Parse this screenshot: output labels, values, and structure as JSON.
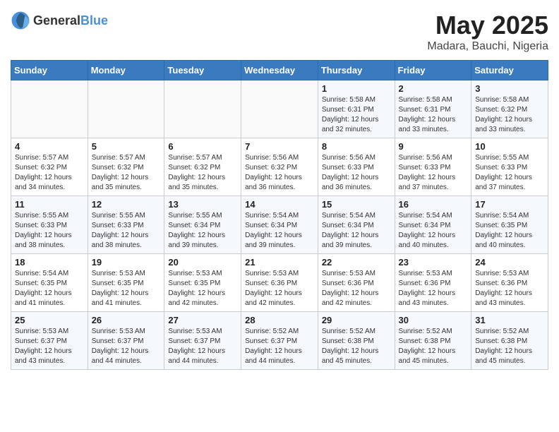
{
  "header": {
    "logo_general": "General",
    "logo_blue": "Blue",
    "month": "May 2025",
    "location": "Madara, Bauchi, Nigeria"
  },
  "weekdays": [
    "Sunday",
    "Monday",
    "Tuesday",
    "Wednesday",
    "Thursday",
    "Friday",
    "Saturday"
  ],
  "weeks": [
    [
      {
        "day": "",
        "info": ""
      },
      {
        "day": "",
        "info": ""
      },
      {
        "day": "",
        "info": ""
      },
      {
        "day": "",
        "info": ""
      },
      {
        "day": "1",
        "info": "Sunrise: 5:58 AM\nSunset: 6:31 PM\nDaylight: 12 hours\nand 32 minutes."
      },
      {
        "day": "2",
        "info": "Sunrise: 5:58 AM\nSunset: 6:31 PM\nDaylight: 12 hours\nand 33 minutes."
      },
      {
        "day": "3",
        "info": "Sunrise: 5:58 AM\nSunset: 6:32 PM\nDaylight: 12 hours\nand 33 minutes."
      }
    ],
    [
      {
        "day": "4",
        "info": "Sunrise: 5:57 AM\nSunset: 6:32 PM\nDaylight: 12 hours\nand 34 minutes."
      },
      {
        "day": "5",
        "info": "Sunrise: 5:57 AM\nSunset: 6:32 PM\nDaylight: 12 hours\nand 35 minutes."
      },
      {
        "day": "6",
        "info": "Sunrise: 5:57 AM\nSunset: 6:32 PM\nDaylight: 12 hours\nand 35 minutes."
      },
      {
        "day": "7",
        "info": "Sunrise: 5:56 AM\nSunset: 6:32 PM\nDaylight: 12 hours\nand 36 minutes."
      },
      {
        "day": "8",
        "info": "Sunrise: 5:56 AM\nSunset: 6:33 PM\nDaylight: 12 hours\nand 36 minutes."
      },
      {
        "day": "9",
        "info": "Sunrise: 5:56 AM\nSunset: 6:33 PM\nDaylight: 12 hours\nand 37 minutes."
      },
      {
        "day": "10",
        "info": "Sunrise: 5:55 AM\nSunset: 6:33 PM\nDaylight: 12 hours\nand 37 minutes."
      }
    ],
    [
      {
        "day": "11",
        "info": "Sunrise: 5:55 AM\nSunset: 6:33 PM\nDaylight: 12 hours\nand 38 minutes."
      },
      {
        "day": "12",
        "info": "Sunrise: 5:55 AM\nSunset: 6:33 PM\nDaylight: 12 hours\nand 38 minutes."
      },
      {
        "day": "13",
        "info": "Sunrise: 5:55 AM\nSunset: 6:34 PM\nDaylight: 12 hours\nand 39 minutes."
      },
      {
        "day": "14",
        "info": "Sunrise: 5:54 AM\nSunset: 6:34 PM\nDaylight: 12 hours\nand 39 minutes."
      },
      {
        "day": "15",
        "info": "Sunrise: 5:54 AM\nSunset: 6:34 PM\nDaylight: 12 hours\nand 39 minutes."
      },
      {
        "day": "16",
        "info": "Sunrise: 5:54 AM\nSunset: 6:34 PM\nDaylight: 12 hours\nand 40 minutes."
      },
      {
        "day": "17",
        "info": "Sunrise: 5:54 AM\nSunset: 6:35 PM\nDaylight: 12 hours\nand 40 minutes."
      }
    ],
    [
      {
        "day": "18",
        "info": "Sunrise: 5:54 AM\nSunset: 6:35 PM\nDaylight: 12 hours\nand 41 minutes."
      },
      {
        "day": "19",
        "info": "Sunrise: 5:53 AM\nSunset: 6:35 PM\nDaylight: 12 hours\nand 41 minutes."
      },
      {
        "day": "20",
        "info": "Sunrise: 5:53 AM\nSunset: 6:35 PM\nDaylight: 12 hours\nand 42 minutes."
      },
      {
        "day": "21",
        "info": "Sunrise: 5:53 AM\nSunset: 6:36 PM\nDaylight: 12 hours\nand 42 minutes."
      },
      {
        "day": "22",
        "info": "Sunrise: 5:53 AM\nSunset: 6:36 PM\nDaylight: 12 hours\nand 42 minutes."
      },
      {
        "day": "23",
        "info": "Sunrise: 5:53 AM\nSunset: 6:36 PM\nDaylight: 12 hours\nand 43 minutes."
      },
      {
        "day": "24",
        "info": "Sunrise: 5:53 AM\nSunset: 6:36 PM\nDaylight: 12 hours\nand 43 minutes."
      }
    ],
    [
      {
        "day": "25",
        "info": "Sunrise: 5:53 AM\nSunset: 6:37 PM\nDaylight: 12 hours\nand 43 minutes."
      },
      {
        "day": "26",
        "info": "Sunrise: 5:53 AM\nSunset: 6:37 PM\nDaylight: 12 hours\nand 44 minutes."
      },
      {
        "day": "27",
        "info": "Sunrise: 5:53 AM\nSunset: 6:37 PM\nDaylight: 12 hours\nand 44 minutes."
      },
      {
        "day": "28",
        "info": "Sunrise: 5:52 AM\nSunset: 6:37 PM\nDaylight: 12 hours\nand 44 minutes."
      },
      {
        "day": "29",
        "info": "Sunrise: 5:52 AM\nSunset: 6:38 PM\nDaylight: 12 hours\nand 45 minutes."
      },
      {
        "day": "30",
        "info": "Sunrise: 5:52 AM\nSunset: 6:38 PM\nDaylight: 12 hours\nand 45 minutes."
      },
      {
        "day": "31",
        "info": "Sunrise: 5:52 AM\nSunset: 6:38 PM\nDaylight: 12 hours\nand 45 minutes."
      }
    ]
  ]
}
